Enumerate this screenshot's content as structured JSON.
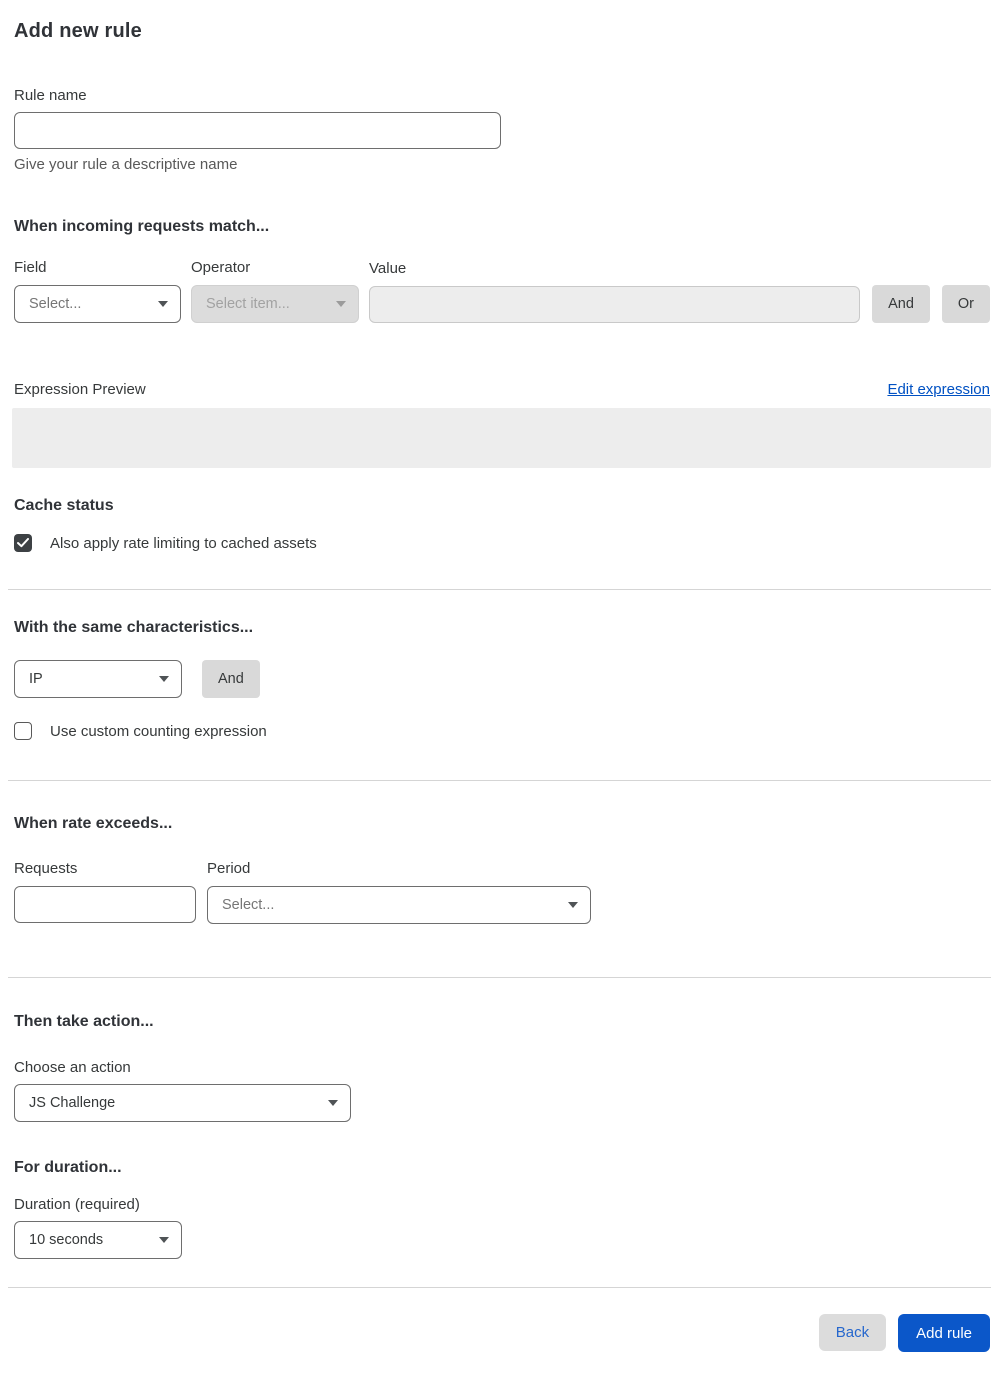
{
  "page": {
    "title": "Add new rule"
  },
  "rule_name": {
    "label": "Rule name",
    "value": "",
    "helper": "Give your rule a descriptive name"
  },
  "match": {
    "heading": "When incoming requests match...",
    "field": {
      "label": "Field",
      "placeholder": "Select..."
    },
    "operator": {
      "label": "Operator",
      "placeholder": "Select item...",
      "disabled": true
    },
    "value": {
      "label": "Value",
      "value": "",
      "disabled": true
    },
    "and_label": "And",
    "or_label": "Or"
  },
  "expression": {
    "label": "Expression Preview",
    "edit_link": "Edit expression",
    "content": ""
  },
  "cache": {
    "heading": "Cache status",
    "checkbox_label": "Also apply rate limiting to cached assets",
    "checked": true
  },
  "characteristics": {
    "heading": "With the same characteristics...",
    "selected": "IP",
    "and_label": "And",
    "custom_counting_label": "Use custom counting expression",
    "custom_counting_checked": false
  },
  "rate": {
    "heading": "When rate exceeds...",
    "requests_label": "Requests",
    "requests_value": "",
    "period_label": "Period",
    "period_placeholder": "Select..."
  },
  "action": {
    "heading": "Then take action...",
    "label": "Choose an action",
    "selected": "JS Challenge"
  },
  "duration": {
    "heading": "For duration...",
    "label": "Duration (required)",
    "selected": "10 seconds"
  },
  "footer": {
    "back_label": "Back",
    "submit_label": "Add rule"
  },
  "colors": {
    "accent_blue": "#0051c3",
    "primary_button_blue": "#0b57c9",
    "checkbox_checked": "#3d4144",
    "disabled_gray": "#dcdcdc"
  }
}
